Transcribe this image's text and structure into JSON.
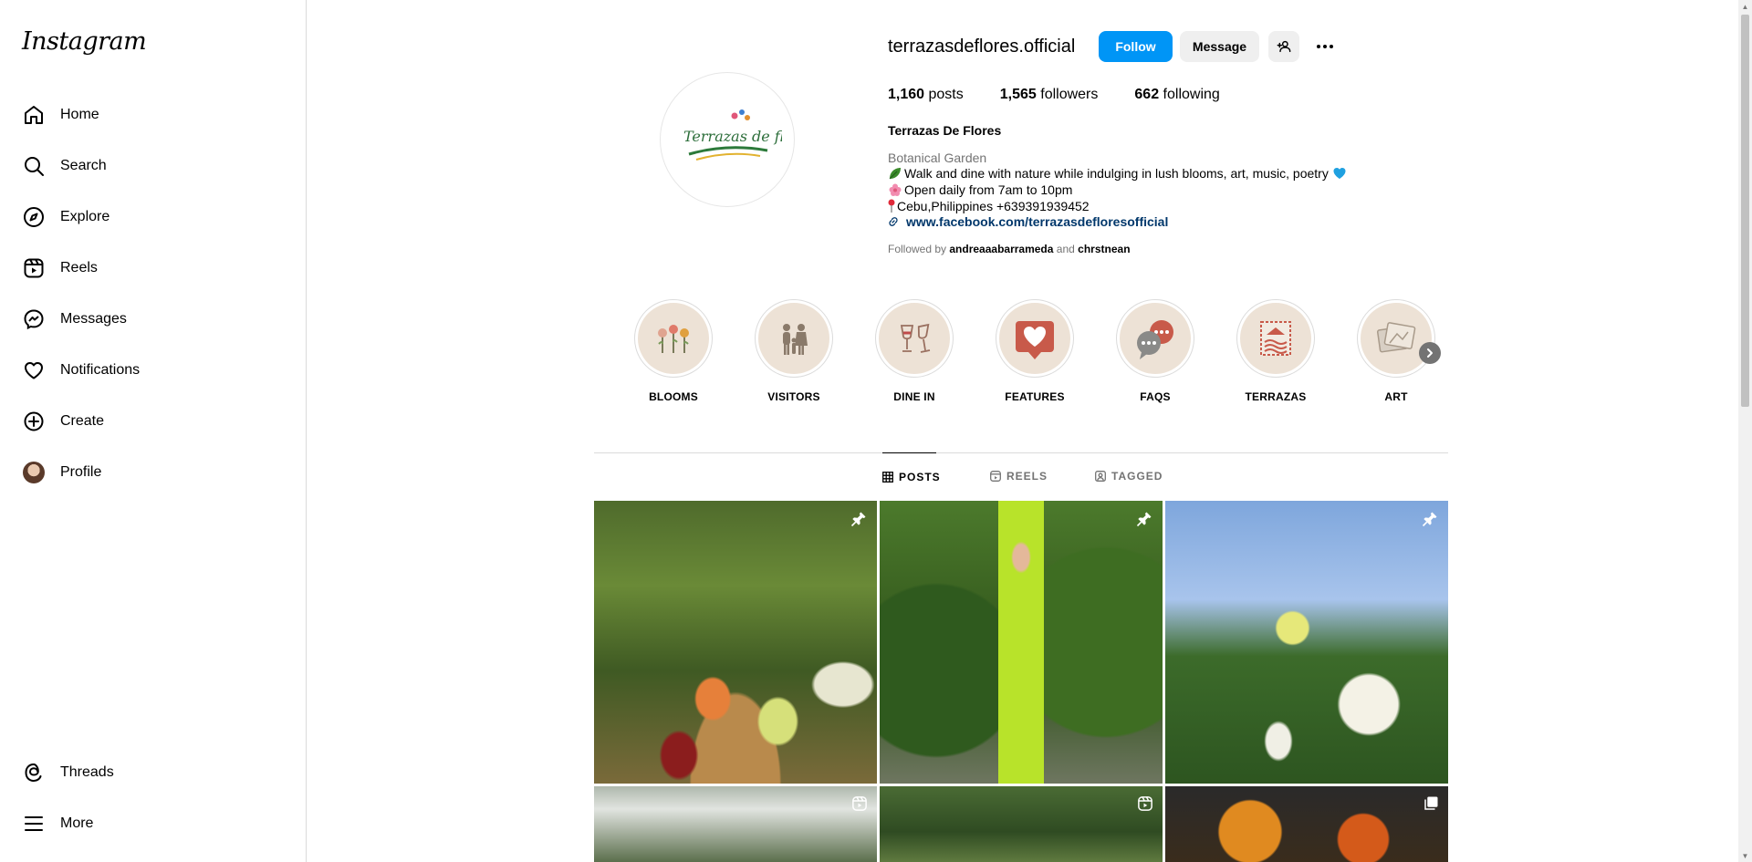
{
  "app": {
    "logo": "Instagram"
  },
  "sidebar": {
    "items": [
      {
        "label": "Home",
        "icon": "home-icon"
      },
      {
        "label": "Search",
        "icon": "search-icon"
      },
      {
        "label": "Explore",
        "icon": "compass-icon"
      },
      {
        "label": "Reels",
        "icon": "reels-icon"
      },
      {
        "label": "Messages",
        "icon": "messenger-icon"
      },
      {
        "label": "Notifications",
        "icon": "heart-icon"
      },
      {
        "label": "Create",
        "icon": "plus-square-icon"
      },
      {
        "label": "Profile",
        "icon": "avatar"
      }
    ],
    "bottom": [
      {
        "label": "Threads",
        "icon": "threads-icon"
      },
      {
        "label": "More",
        "icon": "menu-icon"
      }
    ]
  },
  "profile": {
    "username": "terrazasdeflores.official",
    "follow_label": "Follow",
    "message_label": "Message",
    "stats": {
      "posts_value": "1,160",
      "posts_label": "posts",
      "followers_value": "1,565",
      "followers_label": "followers",
      "following_value": "662",
      "following_label": "following"
    },
    "full_name": "Terrazas De Flores",
    "category": "Botanical Garden",
    "bio": [
      "Walk and dine with nature while indulging in lush blooms, art, music, poetry",
      "Open daily from 7am to 10pm",
      "Cebu,Philippines +639391939452"
    ],
    "link": "www.facebook.com/terrazasdefloresofficial",
    "followed_by_prefix": "Followed by",
    "followed_by_1": "andreaaabarrameda",
    "followed_by_and": "and",
    "followed_by_2": "chrstnean",
    "logo_text": "Terrazas de flores"
  },
  "highlights": [
    {
      "label": "BLOOMS",
      "icon": "flowers-icon"
    },
    {
      "label": "VISITORS",
      "icon": "family-icon"
    },
    {
      "label": "DINE IN",
      "icon": "wine-glasses-icon"
    },
    {
      "label": "FEATURES",
      "icon": "heart-bubble-icon"
    },
    {
      "label": "FAQS",
      "icon": "chat-bubbles-icon"
    },
    {
      "label": "TERRAZAS",
      "icon": "stamp-icon"
    },
    {
      "label": "ART",
      "icon": "picture-frame-icon"
    }
  ],
  "tabs": [
    {
      "label": "POSTS",
      "icon": "grid-icon",
      "active": true
    },
    {
      "label": "REELS",
      "icon": "reels-small-icon",
      "active": false
    },
    {
      "label": "TAGGED",
      "icon": "tag-icon",
      "active": false
    }
  ],
  "posts": [
    {
      "badge": "pin-icon"
    },
    {
      "badge": "pin-icon"
    },
    {
      "badge": "pin-icon"
    },
    {
      "badge": "reel-icon"
    },
    {
      "badge": "reel-icon"
    },
    {
      "badge": "carousel-icon"
    }
  ],
  "colors": {
    "accent": "#0095f6",
    "link": "#00376b",
    "muted": "#737373",
    "highlight_bg": "#ede2d6"
  }
}
